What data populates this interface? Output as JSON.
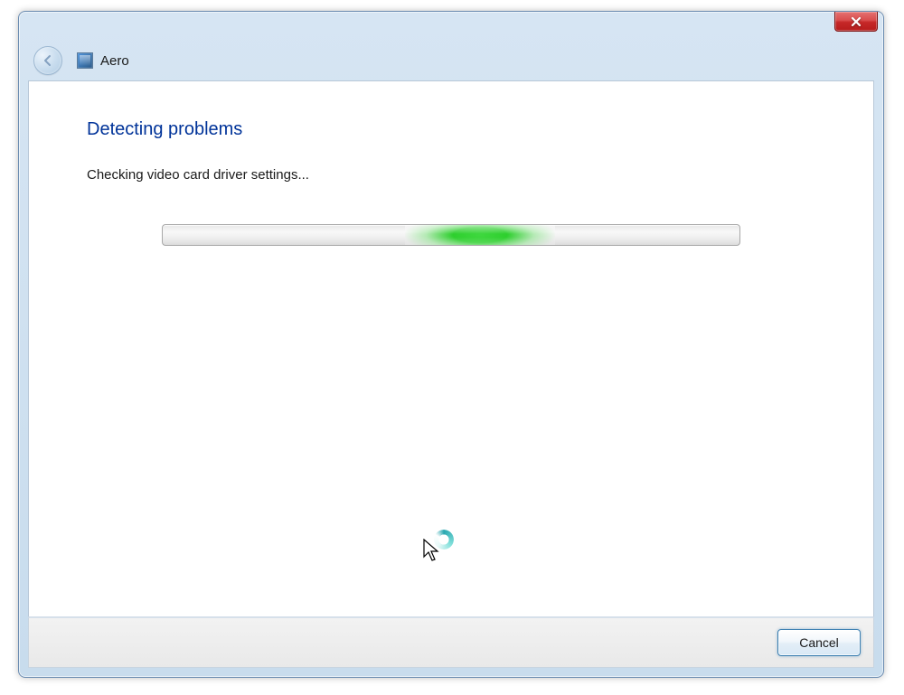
{
  "window": {
    "title": "Aero"
  },
  "content": {
    "heading": "Detecting problems",
    "status": "Checking video card driver settings..."
  },
  "footer": {
    "cancel_label": "Cancel"
  }
}
